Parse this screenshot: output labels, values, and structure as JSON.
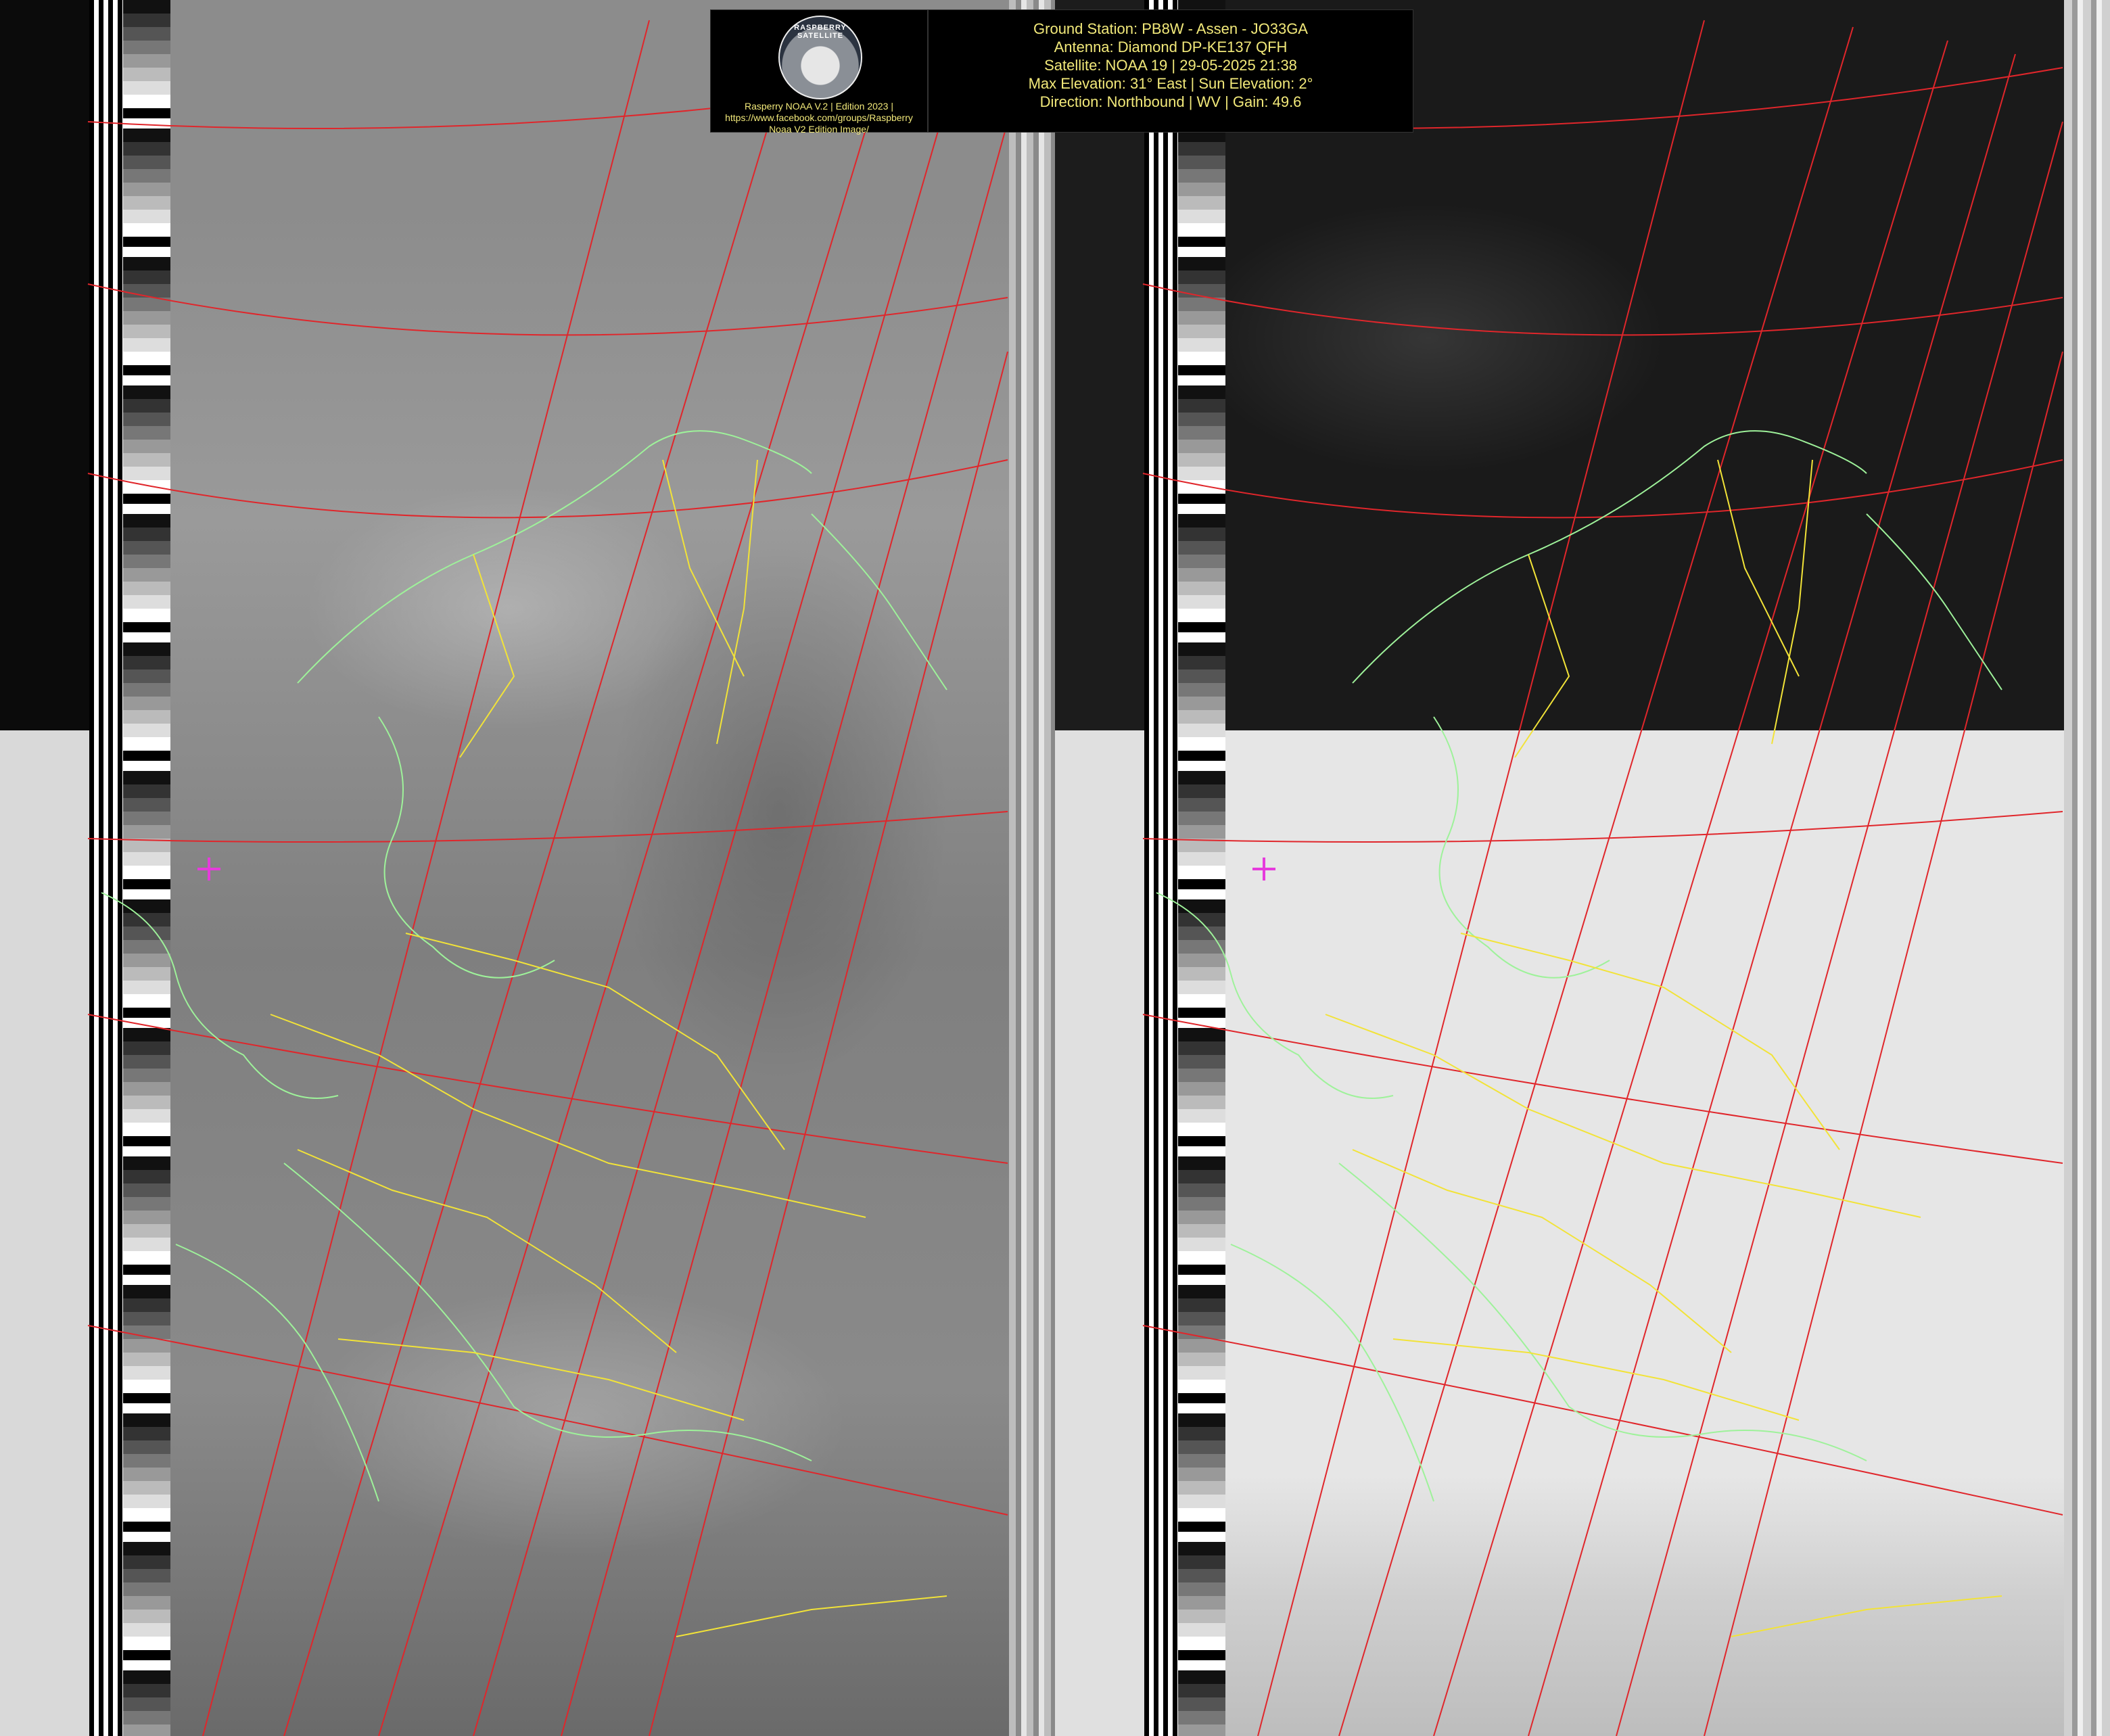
{
  "header": {
    "logo_ring_text": "RASPBERRY SATELLITE",
    "logo_caption_lines": [
      "Rasperry NOAA V.2 | Edition 2023 |",
      "https://www.facebook.com/groups/Raspberry",
      "Noaa V2 Edition Image/"
    ],
    "info_lines": [
      "Ground Station: PB8W - Assen - JO33GA",
      "Antenna: Diamond DP-KE137 QFH",
      "Satellite: NOAA 19 | 29-05-2025 21:38",
      "Max Elevation: 31° East | Sun Elevation: 2°",
      "Direction: Northbound | WV | Gain: 49.6"
    ]
  },
  "colors": {
    "graticule": "#e0262b",
    "coastline": "#9ef29a",
    "border": "#f2e338",
    "marker": "#e63bdc",
    "header_text": "#f2e97a"
  },
  "icons": {
    "logo": "satellite-logo-icon",
    "ground_station_marker": "plus-marker-icon"
  }
}
